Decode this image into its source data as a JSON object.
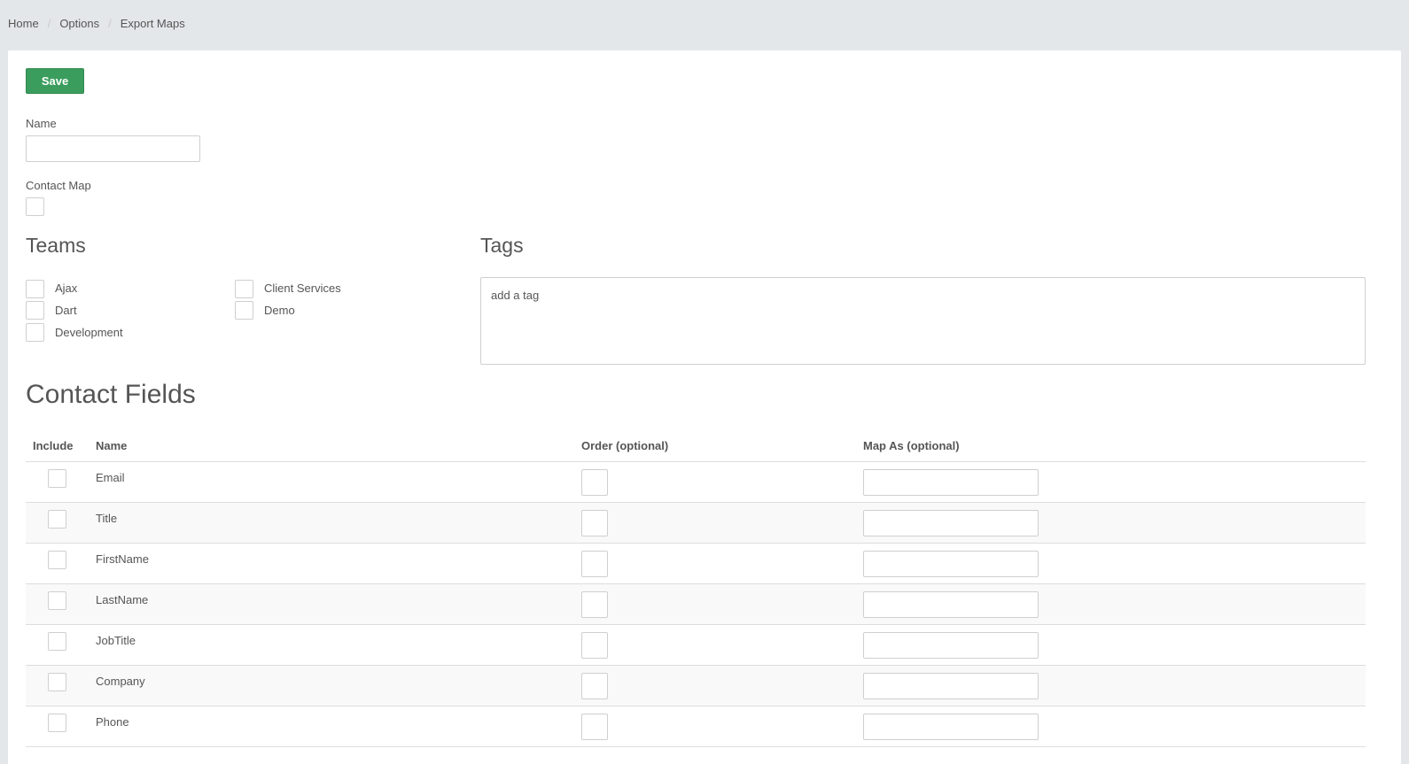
{
  "breadcrumb": [
    "Home",
    "Options",
    "Export Maps"
  ],
  "toolbar": {
    "save_label": "Save"
  },
  "form": {
    "name_label": "Name",
    "name_value": "",
    "contact_map_label": "Contact Map",
    "contact_map_checked": false
  },
  "teams": {
    "heading": "Teams",
    "items": [
      {
        "label": "Ajax",
        "checked": false
      },
      {
        "label": "Client Services",
        "checked": false
      },
      {
        "label": "Dart",
        "checked": false
      },
      {
        "label": "Demo",
        "checked": false
      },
      {
        "label": "Development",
        "checked": false
      }
    ]
  },
  "tags": {
    "heading": "Tags",
    "placeholder": "add a tag"
  },
  "contact_fields": {
    "heading": "Contact Fields",
    "columns": [
      "Include",
      "Name",
      "Order (optional)",
      "Map As (optional)"
    ],
    "rows": [
      {
        "name": "Email",
        "include": false,
        "order": "",
        "map_as": ""
      },
      {
        "name": "Title",
        "include": false,
        "order": "",
        "map_as": ""
      },
      {
        "name": "FirstName",
        "include": false,
        "order": "",
        "map_as": ""
      },
      {
        "name": "LastName",
        "include": false,
        "order": "",
        "map_as": ""
      },
      {
        "name": "JobTitle",
        "include": false,
        "order": "",
        "map_as": ""
      },
      {
        "name": "Company",
        "include": false,
        "order": "",
        "map_as": ""
      },
      {
        "name": "Phone",
        "include": false,
        "order": "",
        "map_as": ""
      }
    ]
  },
  "colors": {
    "page_background": "#e4e7ea",
    "panel_background": "#ffffff",
    "save_button": "#3a9d5d",
    "text": "#555555",
    "border": "#cfcfcf",
    "stripe": "#f9f9f9"
  }
}
